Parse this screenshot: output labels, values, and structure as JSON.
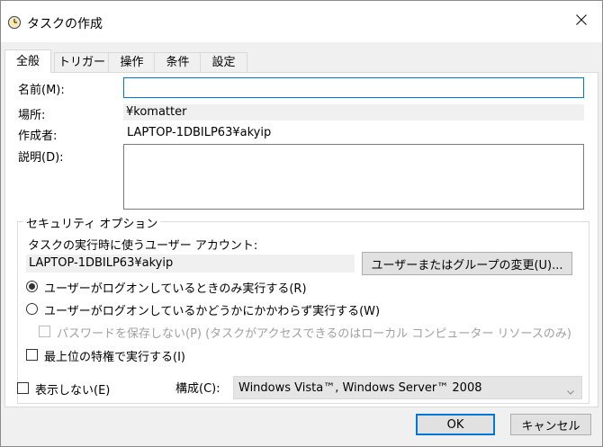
{
  "window": {
    "title": "タスクの作成"
  },
  "tabs": [
    {
      "label": "全般",
      "active": true
    },
    {
      "label": "トリガー",
      "active": false
    },
    {
      "label": "操作",
      "active": false
    },
    {
      "label": "条件",
      "active": false
    },
    {
      "label": "設定",
      "active": false
    }
  ],
  "general": {
    "name_label": "名前(M):",
    "name_value": "",
    "location_label": "場所:",
    "location_value": "¥komatter",
    "author_label": "作成者:",
    "author_value": "LAPTOP-1DBILP63¥akyip",
    "description_label": "説明(D):",
    "description_value": ""
  },
  "security": {
    "group_title": "セキュリティ オプション",
    "account_prompt": "タスクの実行時に使うユーザー アカウント:",
    "account_value": "LAPTOP-1DBILP63¥akyip",
    "change_button": "ユーザーまたはグループの変更(U)...",
    "radio_logged_on": "ユーザーがログオンしているときのみ実行する(R)",
    "radio_whether": "ユーザーがログオンしているかどうかにかかわらず実行する(W)",
    "selected_radio": "logged_on",
    "no_password_label": "パスワードを保存しない(P) (タスクがアクセスできるのはローカル コンピューター リソースのみ)",
    "highest_priv_label": "最上位の特権で実行する(I)"
  },
  "footer": {
    "hidden_label": "表示しない(E)",
    "config_label": "構成(C):",
    "config_value": "Windows Vista™, Windows Server™ 2008",
    "ok_button": "OK",
    "cancel_button": "キャンセル"
  },
  "colors": {
    "focus_accent": "#0078d7",
    "dialog_bg": "#f0f0f0"
  },
  "icons": {
    "title": "clock-icon",
    "close": "close-icon",
    "dropdown": "chevron-down-icon"
  }
}
